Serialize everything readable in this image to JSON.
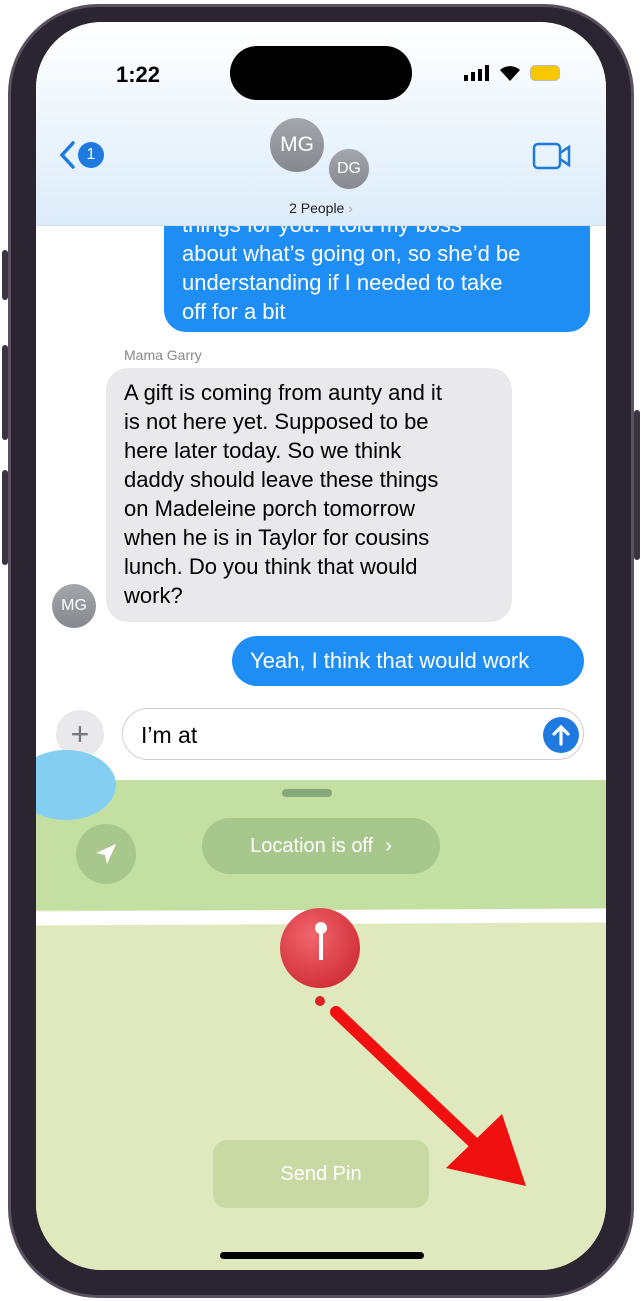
{
  "status": {
    "time": "1:22"
  },
  "header": {
    "back_badge": "1",
    "avatars": [
      "MG",
      "DG"
    ],
    "title": "2 People"
  },
  "messages": [
    {
      "from": "me",
      "lines": [
        "things for you. I told my boss",
        "about what’s going on, so she’d be",
        "understanding if I needed to take",
        "off for a bit"
      ]
    },
    {
      "from": "Mama Garry",
      "sender_label": "Mama Garry",
      "avatar": "MG",
      "lines": [
        "A gift is coming from aunty and it",
        "is not here yet. Supposed to be",
        "here later today. So we think",
        "daddy should leave these things",
        "on Madeleine porch tomorrow",
        "when he is in Taylor for cousins",
        "lunch. Do you think that would",
        "work?"
      ]
    },
    {
      "from": "me",
      "lines": [
        "Yeah, I think that would work"
      ]
    }
  ],
  "composer": {
    "value": "I’m at"
  },
  "map": {
    "location_label": "Location is off",
    "send_pin": "Send Pin"
  },
  "colors": {
    "accent": "#1f8ef4",
    "pin": "#e0343f",
    "arrow": "#f01010"
  }
}
